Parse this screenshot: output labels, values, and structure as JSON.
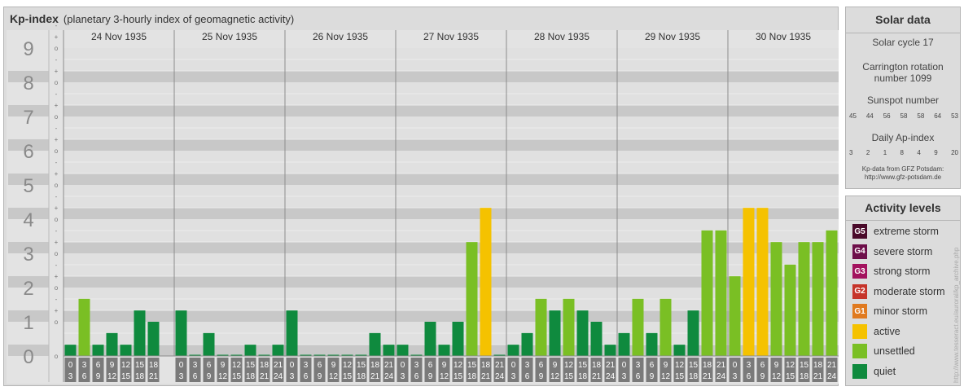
{
  "chart_data": {
    "type": "bar",
    "title": "Kp-index",
    "subtitle": "(planetary 3-hourly index of geomagnetic activity)",
    "ylim": [
      0,
      9
    ],
    "y_ticks": [
      "0",
      "1",
      "2",
      "3",
      "4",
      "5",
      "6",
      "7",
      "8",
      "9"
    ],
    "y_minor_ticks": [
      "o",
      "+",
      "-"
    ],
    "days": [
      "24 Nov 1935",
      "25 Nov 1935",
      "26 Nov 1935",
      "27 Nov 1935",
      "28 Nov 1935",
      "29 Nov 1935",
      "30 Nov 1935"
    ],
    "interval_start": [
      "0",
      "3",
      "6",
      "9",
      "12",
      "15",
      "18",
      "21"
    ],
    "interval_end": [
      "3",
      "6",
      "9",
      "12",
      "15",
      "18",
      "21",
      "24"
    ],
    "values": [
      [
        0.33,
        1.67,
        0.33,
        0.67,
        0.33,
        1.33,
        1.0
      ],
      [
        1.33,
        0,
        0.67,
        0,
        0,
        0.33,
        0,
        0.33
      ],
      [
        1.33,
        0,
        0,
        0,
        0,
        0,
        0.67,
        0.33
      ],
      [
        0.33,
        0,
        1.0,
        0.33,
        1.0,
        3.33,
        4.33,
        0
      ],
      [
        0.33,
        0.67,
        1.67,
        1.33,
        1.67,
        1.33,
        1.0,
        0.33
      ],
      [
        0.67,
        1.67,
        0.67,
        1.67,
        0.33,
        1.33,
        3.67,
        3.67
      ],
      [
        2.33,
        4.33,
        4.33,
        3.33,
        2.67,
        3.33,
        3.33,
        3.67
      ]
    ],
    "colors": {
      "quiet": "#0f8a3e",
      "unsettled": "#7abf24",
      "active": "#f5c200"
    }
  },
  "solar_data": {
    "title": "Solar data",
    "solar_cycle": "Solar cycle 17",
    "carrington_line1": "Carrington rotation",
    "carrington_line2": "number 1099",
    "sunspot_label": "Sunspot number",
    "sunspot_values": [
      "45",
      "44",
      "56",
      "58",
      "58",
      "64",
      "53"
    ],
    "ap_label": "Daily Ap-index",
    "ap_values": [
      "3",
      "2",
      "1",
      "8",
      "4",
      "9",
      "20"
    ],
    "source_line1": "Kp-data from GFZ Potsdam:",
    "source_line2": "http://www.gfz-potsdam.de"
  },
  "activity_levels": {
    "title": "Activity levels",
    "items": [
      {
        "code": "G5",
        "label": "extreme storm",
        "color": "#4a0a2a"
      },
      {
        "code": "G4",
        "label": "severe storm",
        "color": "#6e0f4a"
      },
      {
        "code": "G3",
        "label": "strong storm",
        "color": "#a3125e"
      },
      {
        "code": "G2",
        "label": "moderate storm",
        "color": "#c6342a"
      },
      {
        "code": "G1",
        "label": "minor storm",
        "color": "#e07a1f"
      },
      {
        "code": "",
        "label": "active",
        "color": "#f5c200"
      },
      {
        "code": "",
        "label": "unsettled",
        "color": "#7abf24"
      },
      {
        "code": "",
        "label": "quiet",
        "color": "#0f8a3e"
      }
    ]
  },
  "watermark": "http://www.tesseract.eu/auroral/kp_archive.php"
}
